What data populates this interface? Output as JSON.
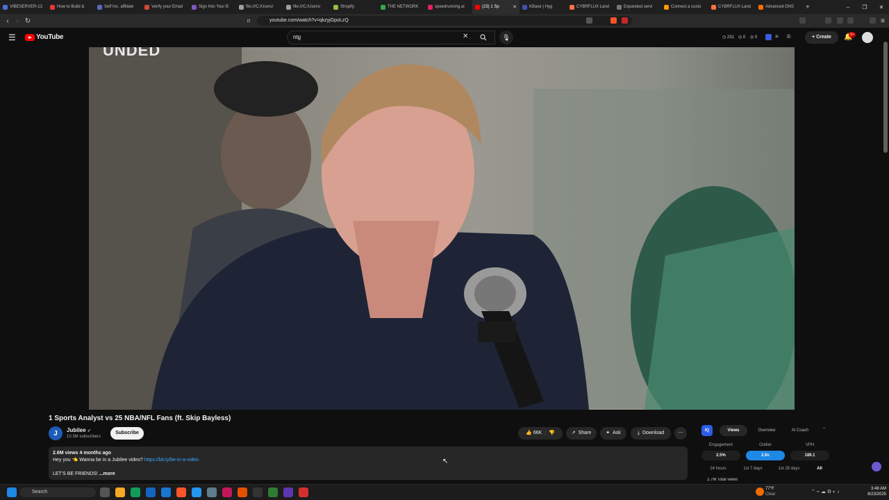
{
  "browser": {
    "tabs": [
      {
        "label": "VIBESERVER-13",
        "color": "#4a6ee0"
      },
      {
        "label": "How to Build &",
        "color": "#e53935"
      },
      {
        "label": "Self Inc. affiliate",
        "color": "#5c6bc0"
      },
      {
        "label": "Verify your Email",
        "color": "#d44638"
      },
      {
        "label": "Sign Into Your B",
        "color": "#7e57c2"
      },
      {
        "label": "file:///C:/Users/",
        "color": "#9e9e9e"
      },
      {
        "label": "file:///C:/Users/",
        "color": "#9e9e9e"
      },
      {
        "label": "Shopify",
        "color": "#95bf47"
      },
      {
        "label": "THE NETWORK",
        "color": "#34a853"
      },
      {
        "label": "speedrunning.ai",
        "color": "#e91e63"
      },
      {
        "label": "(23) 1 Sp",
        "color": "#ff0000",
        "active": true
      },
      {
        "label": "KBase | Hyg",
        "color": "#3f51b5"
      },
      {
        "label": "CYBRFLUX Land",
        "color": "#ff7043"
      },
      {
        "label": "Expanded servi",
        "color": "#757575"
      },
      {
        "label": "Connect a custo",
        "color": "#ff9800"
      },
      {
        "label": "CYBRFLUX Land",
        "color": "#ff7043"
      },
      {
        "label": "Advanced DNS",
        "color": "#ff6f00"
      }
    ],
    "new_tab_label": "+",
    "window_controls": [
      "–",
      "❐",
      "✕"
    ],
    "url": "youtube.com/watch?v=qkzyjGpoLzQ"
  },
  "youtube": {
    "logo_text": "YouTube",
    "search_value": "ntg",
    "header_stats": {
      "count1": "231",
      "count2": "0",
      "count3": "0"
    },
    "create_label": "Create",
    "notif_badge": "9+"
  },
  "video": {
    "overlay_text": "UNDED",
    "title": "1 Sports Analyst vs 25 NBA/NFL Fans (ft. Skip Bayless)",
    "channel": {
      "name": "Jubilee",
      "avatar_letter": "J",
      "subscribers": "10.3M subscribers"
    },
    "subscribe_label": "Subscribe",
    "actions": {
      "likes": "66K",
      "share": "Share",
      "ask": "Ask",
      "download": "Download"
    },
    "description": {
      "meta": "2.6M views  4 months ago",
      "line1_text": "Hey you 👈 Wanna be in a Jubilee video? ",
      "line1_link": "https://bit.ly/be-in-a-video",
      "line2": "LET'S BE FRIENDS!",
      "more": "...more"
    }
  },
  "vidiq": {
    "badge": "IQ",
    "tabs": [
      "Views",
      "Overview",
      "AI Coach"
    ],
    "metrics": [
      {
        "label": "Engagement",
        "value": "2.5%"
      },
      {
        "label": "Outlier",
        "value": "2.8x"
      },
      {
        "label": "VPH",
        "value": "189.1"
      }
    ],
    "ranges": [
      "24 hours",
      "1st 7 days",
      "1st 28 days",
      "All"
    ],
    "footer": "2.7M  Total views"
  },
  "taskbar": {
    "search_placeholder": "Search",
    "weather": {
      "temp": "77°F",
      "condition": "Clear"
    },
    "time": "3:48 AM",
    "date": "8/23/2025"
  }
}
